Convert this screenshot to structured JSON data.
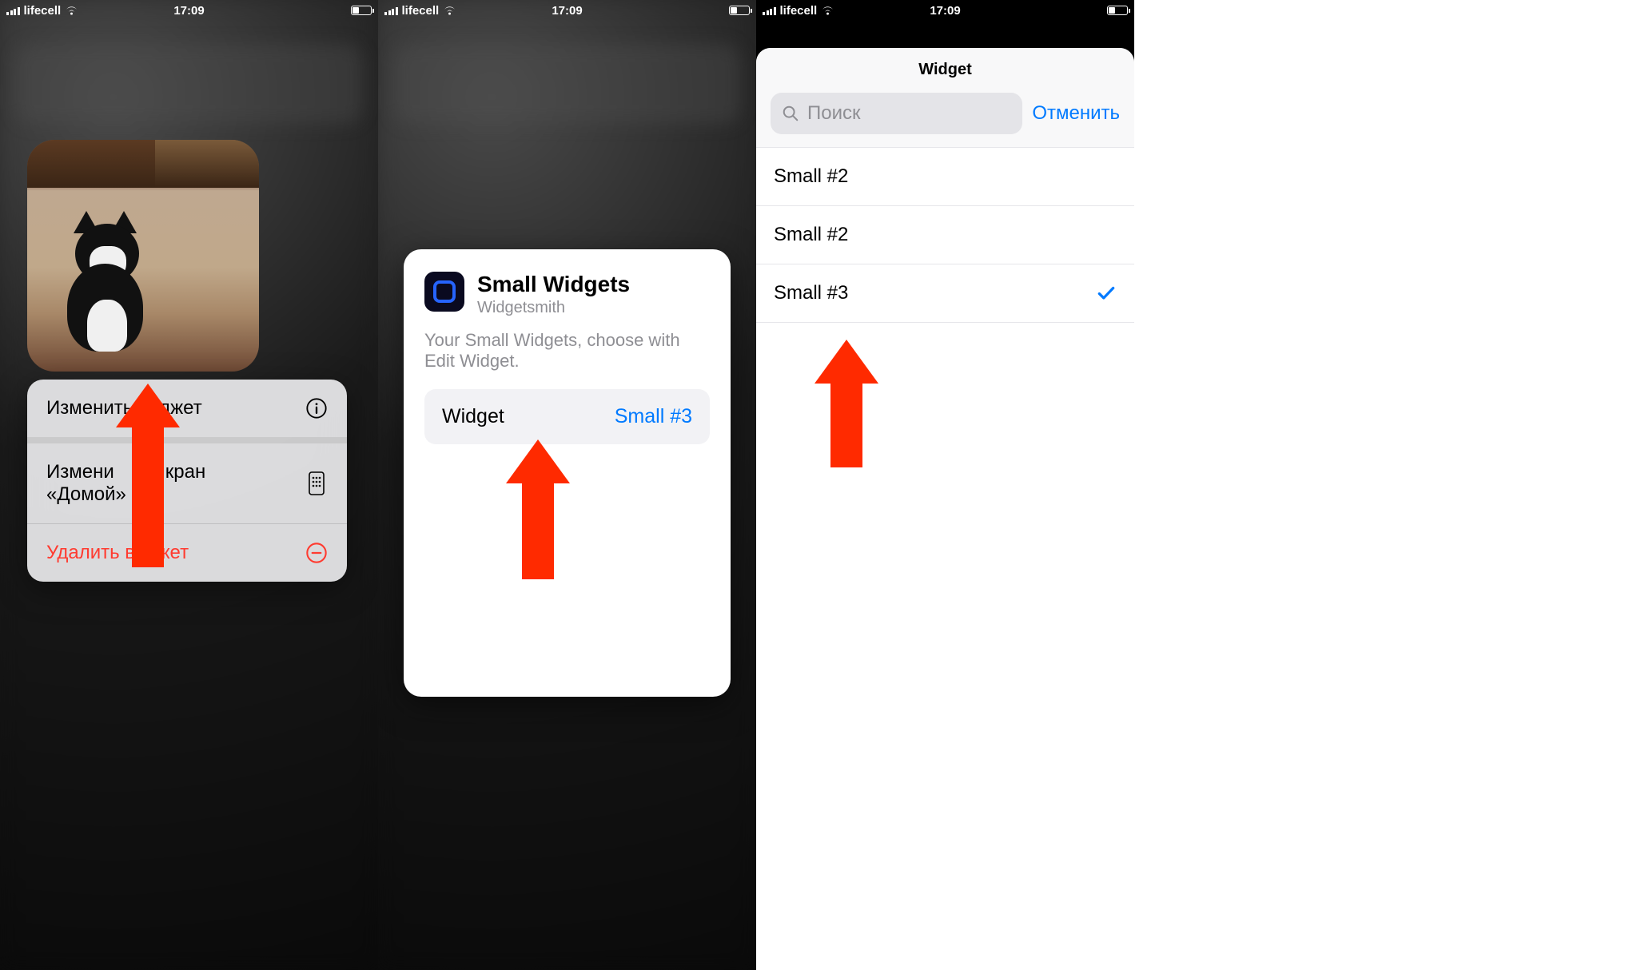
{
  "status": {
    "carrier": "lifecell",
    "time": "17:09"
  },
  "screen1": {
    "menu": {
      "edit_widget": "Изменить виджет",
      "edit_home_line1": "Измени",
      "edit_home_line2_cont": "кран",
      "edit_home_line2": "«Домой»",
      "remove_widget": "Удалить виджет"
    }
  },
  "screen2": {
    "title": "Small Widgets",
    "app": "Widgetsmith",
    "description": "Your Small Widgets, choose with Edit Widget.",
    "row_label": "Widget",
    "row_value": "Small #3"
  },
  "screen3": {
    "header": "Widget",
    "search_placeholder": "Поиск",
    "cancel": "Отменить",
    "options": [
      {
        "label": "Small #2",
        "selected": false
      },
      {
        "label": "Small #2",
        "selected": false
      },
      {
        "label": "Small #3",
        "selected": true
      }
    ]
  }
}
